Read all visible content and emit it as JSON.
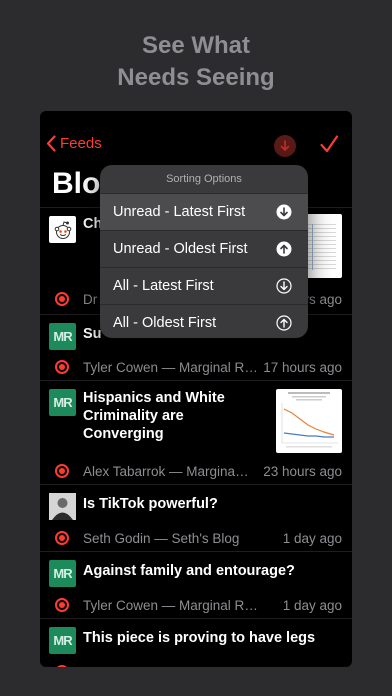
{
  "promo": {
    "line1": "See What",
    "line2": "Needs Seeing"
  },
  "nav": {
    "back_label": "Feeds",
    "large_title": "Blog"
  },
  "sorting": {
    "title": "Sorting Options",
    "options": [
      {
        "label": "Unread - Latest First",
        "icon": "arrow-down-circle-filled-icon"
      },
      {
        "label": "Unread - Oldest First",
        "icon": "arrow-up-circle-filled-icon"
      },
      {
        "label": "All - Latest First",
        "icon": "arrow-down-circle-outline-icon"
      },
      {
        "label": "All - Oldest First",
        "icon": "arrow-up-circle-outline-icon"
      }
    ]
  },
  "articles": [
    {
      "title": "Ch",
      "source": "Dr",
      "time": "rs ago",
      "avatar": "reddit-avatar"
    },
    {
      "title": "Su",
      "source": "Tyler Cowen — Marginal RE...",
      "time": "17 hours ago",
      "avatar": "MR"
    },
    {
      "title": "Hispanics and White Criminality are Converging",
      "source": "Alex Tabarrok — Marginal...",
      "time": "23 hours ago",
      "avatar": "MR"
    },
    {
      "title": "Is TikTok powerful?",
      "source": "Seth Godin — Seth's Blog",
      "time": "1 day ago",
      "avatar": "seth-avatar"
    },
    {
      "title": "Against family and entourage?",
      "source": "Tyler Cowen — Marginal REV...",
      "time": "1 day ago",
      "avatar": "MR"
    },
    {
      "title": "This piece is proving to have legs",
      "source": "",
      "time": "",
      "avatar": "MR"
    }
  ],
  "colors": {
    "accent": "#ff3b30",
    "background": "#000000",
    "popup": "#3a3a3c",
    "mr_green": "#1d8a5c"
  }
}
